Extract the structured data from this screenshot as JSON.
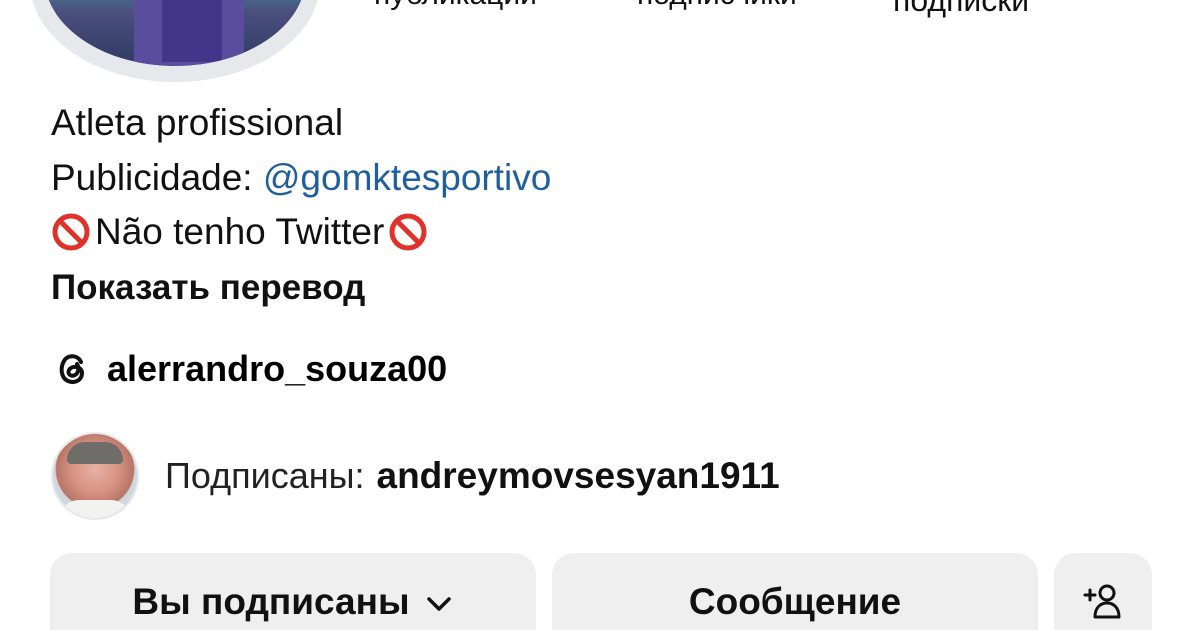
{
  "profile": {
    "stats": {
      "posts_label": "публикации",
      "followers_label": "подписчики",
      "following_label": "подписки"
    },
    "bio": {
      "line1": "Atleta profissional",
      "line2_prefix": "Publicidade: ",
      "line2_link": "@gomktesportivo",
      "line3_text": "Não tenho Twitter ",
      "show_translation": "Показать перевод"
    },
    "threads_username": "alerrandro_souza00",
    "followed_by": {
      "label": "Подписаны:",
      "username": "andreymovsesyan1911"
    }
  },
  "buttons": {
    "following": "Вы подписаны",
    "message": "Сообщение"
  },
  "colors": {
    "link": "#1f5f9e",
    "button_bg": "#efefef",
    "no_entry_red": "#e0312a"
  },
  "icons": {
    "no_entry": "no-entry-emoji",
    "threads": "threads-logo-icon",
    "chevron": "chevron-down-icon",
    "add_user": "add-user-icon"
  }
}
